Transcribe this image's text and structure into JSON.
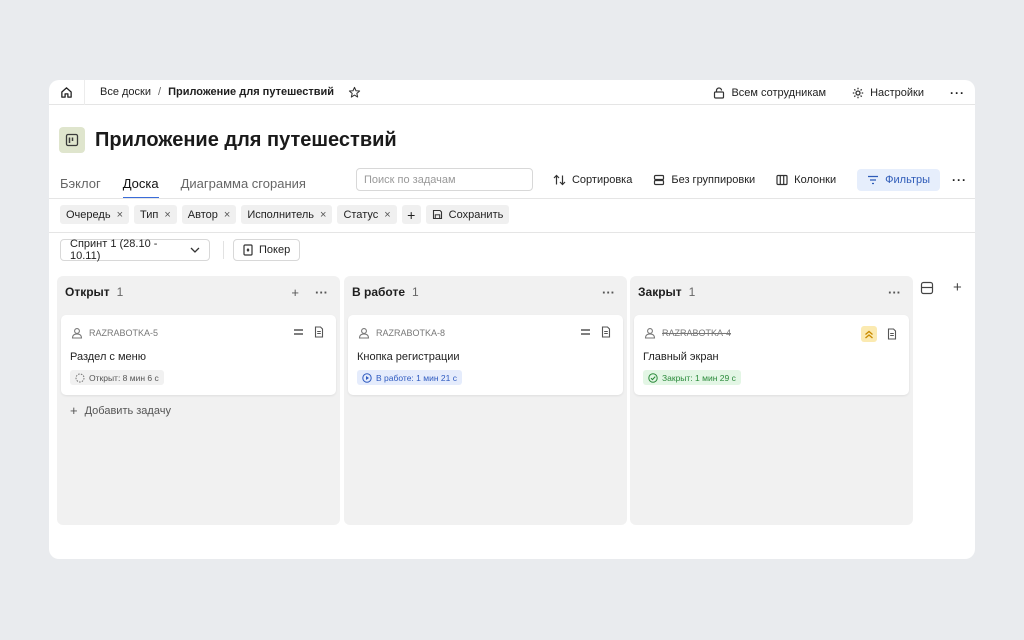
{
  "breadcrumb": {
    "root": "Все доски",
    "separator": "/",
    "current": "Приложение для путешествий"
  },
  "topbar": {
    "share_label": "Всем сотрудникам",
    "settings_label": "Настройки",
    "more": "···"
  },
  "project": {
    "title": "Приложение для путешествий"
  },
  "tabs": [
    {
      "label": "Бэклог",
      "active": false
    },
    {
      "label": "Доска",
      "active": true
    },
    {
      "label": "Диаграмма сгорания",
      "active": false
    }
  ],
  "search": {
    "placeholder": "Поиск по задачам"
  },
  "toolbar": {
    "sort": "Сортировка",
    "group": "Без группировки",
    "columns": "Колонки",
    "filters": "Фильтры",
    "more": "···"
  },
  "filter_chips": [
    "Очередь",
    "Тип",
    "Автор",
    "Исполнитель",
    "Статус"
  ],
  "filter_close": "×",
  "filter_add": "+",
  "save_label": "Сохранить",
  "sprint": {
    "label": "Спринт 1 (28.10 - 10.11)"
  },
  "poker": {
    "label": "Покер"
  },
  "columns": [
    {
      "name": "Открыт",
      "count": "1",
      "card": {
        "key": "RAZRABOTKA-5",
        "title": "Раздел с меню",
        "status": "Открыт: 8 мин 6 с"
      },
      "add_task": "Добавить задачу"
    },
    {
      "name": "В работе",
      "count": "1",
      "card": {
        "key": "RAZRABOTKA-8",
        "title": "Кнопка регистрации",
        "status": "В работе: 1 мин 21 с"
      }
    },
    {
      "name": "Закрыт",
      "count": "1",
      "card": {
        "key": "RAZRABOTKA-4",
        "title": "Главный экран",
        "status": "Закрыт: 1 мин 29 с"
      }
    }
  ],
  "col_plus": "+",
  "col_more": "···",
  "add_task_plus": "+",
  "colors": {
    "accent": "#3a6cd9",
    "filters_bg": "#e6eefc",
    "work_status": "#2f5bc0",
    "done_status": "#2a8a3a",
    "priority_bg": "#fbeab1"
  }
}
